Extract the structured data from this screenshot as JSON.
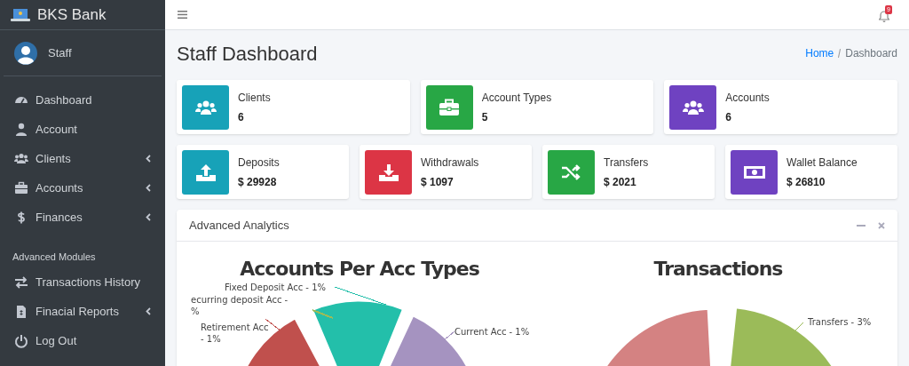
{
  "brand": {
    "name": "BKS Bank"
  },
  "user": {
    "name": "Staff"
  },
  "sidebar": {
    "items": [
      {
        "label": "Dashboard",
        "has_submenu": false
      },
      {
        "label": "Account",
        "has_submenu": false
      },
      {
        "label": "Clients",
        "has_submenu": true
      },
      {
        "label": "Accounts",
        "has_submenu": true
      },
      {
        "label": "Finances",
        "has_submenu": true
      }
    ],
    "section_header": "Advanced Modules",
    "module_items": [
      {
        "label": "Transactions History",
        "has_submenu": false
      },
      {
        "label": "Finacial Reports",
        "has_submenu": true
      },
      {
        "label": "Log Out",
        "has_submenu": false
      }
    ]
  },
  "topbar": {
    "notification_count": "9"
  },
  "page_title": "Staff Dashboard",
  "breadcrumb": [
    {
      "label": "Home",
      "active": false
    },
    {
      "label": "Dashboard",
      "active": true
    }
  ],
  "stats_row_1": [
    {
      "label": "Clients",
      "value": "6",
      "color": "#17a2b8"
    },
    {
      "label": "Account Types",
      "value": "5",
      "color": "#28a745"
    },
    {
      "label": "Accounts",
      "value": "6",
      "color": "#6f42c1"
    }
  ],
  "stats_row_2": [
    {
      "label": "Deposits",
      "value": "$ 29928",
      "color": "#17a2b8"
    },
    {
      "label": "Withdrawals",
      "value": "$ 1097",
      "color": "#dc3545"
    },
    {
      "label": "Transfers",
      "value": "$ 2021",
      "color": "#28a745"
    },
    {
      "label": "Wallet Balance",
      "value": "$ 26810",
      "color": "#6f42c1"
    }
  ],
  "panel": {
    "title": "Advanced Analytics",
    "charts": [
      {
        "title": "Accounts Per Acc Types",
        "slices": [
          {
            "label": [
              "Fixed Deposit Acc - 1%"
            ],
            "color": "#23bfaa"
          },
          {
            "label": [
              "ecurring deposit Acc  -",
              "%"
            ],
            "color": "#9bbb59"
          },
          {
            "label": [
              "Retirement Acc",
              "- 1%"
            ],
            "color": "#c0504d"
          },
          {
            "label": [
              "Current Acc - 1%"
            ],
            "color": "#a593c0"
          }
        ]
      },
      {
        "title": "Transactions",
        "slices": [
          {
            "label": [
              "Transfers - 3%"
            ],
            "color": "#9bbb59"
          },
          {
            "color": "#d48282"
          }
        ]
      }
    ]
  }
}
